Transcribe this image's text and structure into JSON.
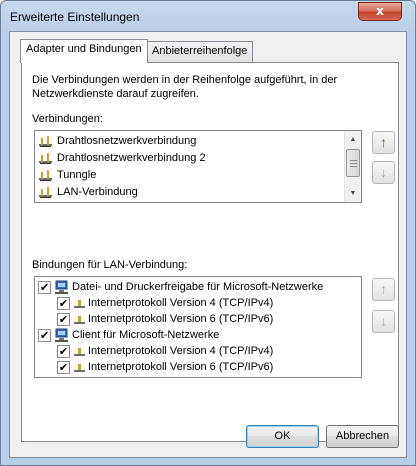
{
  "window": {
    "title": "Erweiterte Einstellungen",
    "close_glyph": "x"
  },
  "tabs": [
    {
      "label": "Adapter und Bindungen",
      "active": true
    },
    {
      "label": "Anbieterreihenfolge",
      "active": false
    }
  ],
  "description": "Die Verbindungen werden in der Reihenfolge aufgeführt, in der Netzwerkdienste darauf zugreifen.",
  "connections": {
    "label": "Verbindungen:",
    "items": [
      "Drahtlosnetzwerkverbindung",
      "Drahtlosnetzwerkverbindung 2",
      "Tunngle",
      "LAN-Verbindung"
    ]
  },
  "bindings": {
    "label": "Bindungen für LAN-Verbindung:",
    "items": [
      {
        "label": "Datei- und Druckerfreigabe für Microsoft-Netzwerke",
        "checked": true,
        "level": 0,
        "icon": "computer-network-icon"
      },
      {
        "label": "Internetprotokoll Version 4 (TCP/IPv4)",
        "checked": true,
        "level": 1,
        "icon": "protocol-icon"
      },
      {
        "label": "Internetprotokoll Version 6 (TCP/IPv6)",
        "checked": true,
        "level": 1,
        "icon": "protocol-icon"
      },
      {
        "label": "Client für Microsoft-Netzwerke",
        "checked": true,
        "level": 0,
        "icon": "client-computer-icon"
      },
      {
        "label": "Internetprotokoll Version 4 (TCP/IPv4)",
        "checked": true,
        "level": 1,
        "icon": "protocol-icon"
      },
      {
        "label": "Internetprotokoll Version 6 (TCP/IPv6)",
        "checked": true,
        "level": 1,
        "icon": "protocol-icon"
      }
    ]
  },
  "side_buttons": {
    "move_up_glyph": "↑",
    "move_down_glyph": "↓",
    "up_enabled_color": "#1d9a1d",
    "disabled_color": "#a8a8a8"
  },
  "buttons": {
    "ok": "OK",
    "cancel": "Abbrechen"
  }
}
